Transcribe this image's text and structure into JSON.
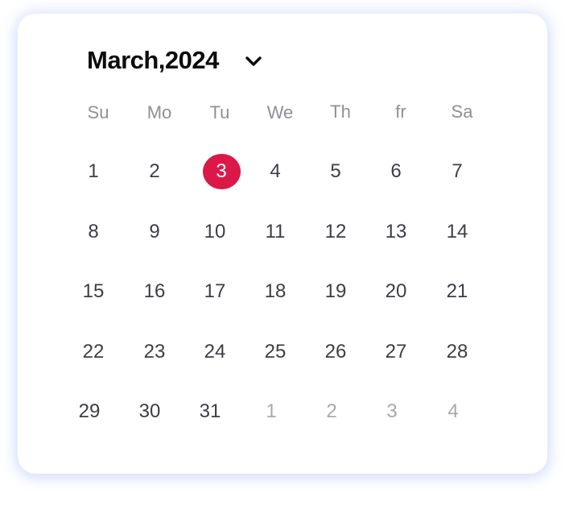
{
  "calendar": {
    "month_label": "March,2024",
    "dropdown_icon": "chevron-down-icon",
    "weekdays": [
      "Su",
      "Mo",
      "Tu",
      "We",
      "Th",
      "fr",
      "Sa"
    ],
    "weeks": [
      [
        "1",
        "2",
        "3",
        "4",
        "5",
        "6",
        "7"
      ],
      [
        "8",
        "9",
        "10",
        "11",
        "12",
        "13",
        "14"
      ],
      [
        "15",
        "16",
        "17",
        "18",
        "19",
        "20",
        "21"
      ],
      [
        "22",
        "23",
        "24",
        "25",
        "26",
        "27",
        "28"
      ],
      [
        "29",
        "30",
        "31",
        "1",
        "2",
        "3",
        "4"
      ]
    ],
    "selected_day": "3",
    "next_month_days": [
      "1",
      "2",
      "3",
      "4"
    ]
  },
  "colors": {
    "selected_bg": "#dc1849",
    "weekday_text": "#8f9096",
    "day_text": "#3d3e45",
    "other_month_text": "#a8a9ae",
    "card_glow": "#6e96f5"
  }
}
